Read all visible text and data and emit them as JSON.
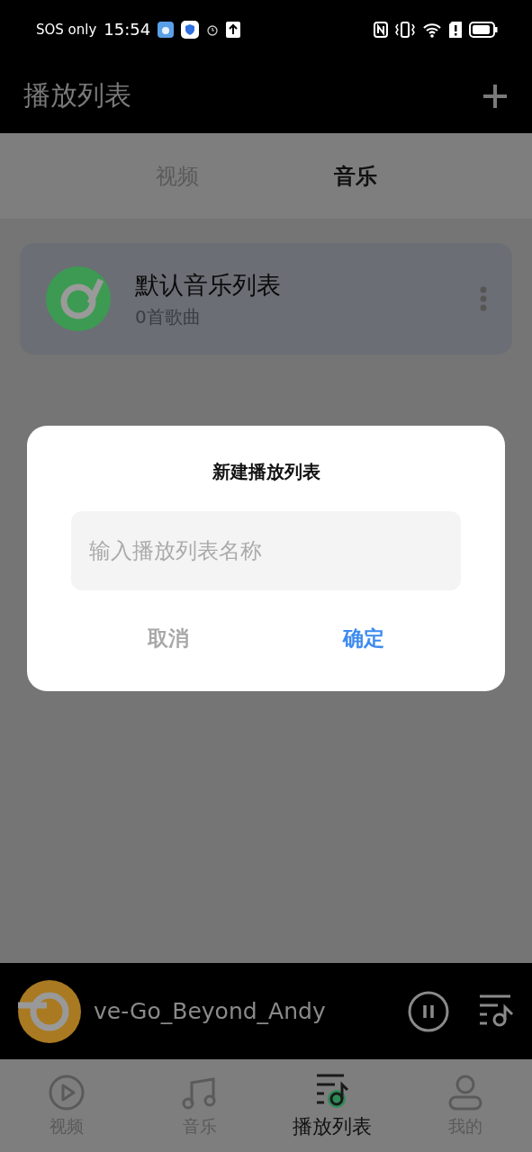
{
  "status_bar": {
    "carrier": "SOS only",
    "time": "15:54"
  },
  "header": {
    "title": "播放列表"
  },
  "tabs": [
    {
      "label": "视频",
      "selected": false
    },
    {
      "label": "音乐",
      "selected": true
    }
  ],
  "playlists": [
    {
      "name": "默认音乐列表",
      "count": "0首歌曲"
    }
  ],
  "dialog": {
    "title": "新建播放列表",
    "placeholder": "输入播放列表名称",
    "buttons": [
      {
        "label": "取消",
        "kind": "cancel"
      },
      {
        "label": "确定",
        "kind": "confirm"
      }
    ]
  },
  "mini_player": {
    "title": "ve-Go_Beyond_Andy",
    "playing": true
  },
  "bottom_nav": [
    {
      "label": "视频",
      "kind": "video",
      "selected": false
    },
    {
      "label": "音乐",
      "kind": "music",
      "selected": false
    },
    {
      "label": "播放列表",
      "kind": "playlist",
      "selected": true
    },
    {
      "label": "我的",
      "kind": "profile",
      "selected": false
    }
  ]
}
